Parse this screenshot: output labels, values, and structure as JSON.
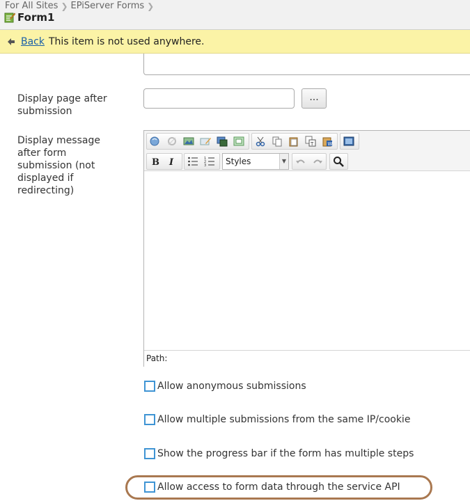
{
  "header": {
    "breadcrumbs": [
      "For All Sites",
      "EPiServer Forms"
    ],
    "title": "Form1"
  },
  "notice": {
    "back_label": "Back",
    "message": "This item is not used anywhere."
  },
  "fields": {
    "display_page_label": "Display page after submission",
    "display_page_value": "",
    "browse_label": "...",
    "display_message_label": "Display message after form submission (not displayed if redirecting)"
  },
  "editor": {
    "styles_value": "Styles",
    "path_label": "Path:"
  },
  "checkboxes": [
    {
      "label": "Allow anonymous submissions",
      "checked": false
    },
    {
      "label": "Allow multiple submissions from the same IP/cookie",
      "checked": false
    },
    {
      "label": "Show the progress bar if the form has multiple steps",
      "checked": false
    },
    {
      "label": "Allow access to form data through the service API",
      "checked": false
    }
  ],
  "colors": {
    "notice_bg": "#fbf3a6",
    "checkbox_border": "#3f94d4",
    "highlight_outline": "#a97850",
    "link": "#1a5fa8"
  }
}
